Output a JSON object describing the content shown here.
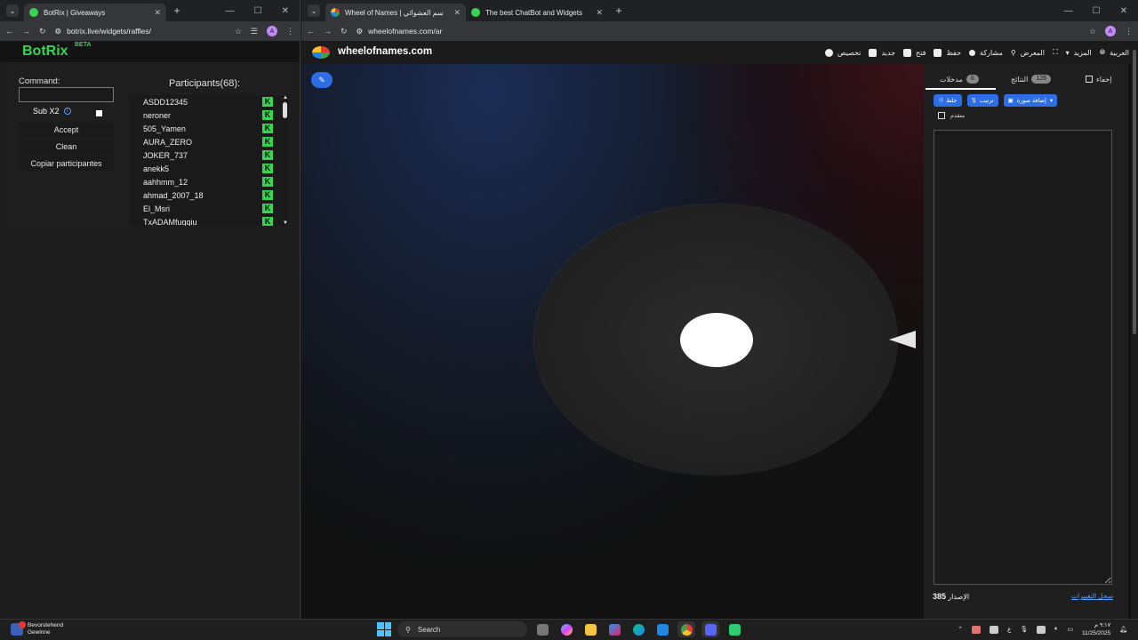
{
  "left_browser": {
    "tab_title": "BotRix | Giveaways",
    "url": "botrix.live/widgets/raffles/",
    "avatar": "A"
  },
  "botrix": {
    "logo": "BotRix",
    "beta": "BETA",
    "command_label": "Command:",
    "command_value": "",
    "sub_label": "Sub X2",
    "accept_label": "Accept",
    "clean_label": "Clean",
    "copy_label": "Copiar participantes",
    "participants_title": "Participants(68):",
    "participants": [
      "ASDD12345",
      "neroner",
      "505_Yamen",
      "AURA_ZERO",
      "JOKER_737",
      "anekk5",
      "aahhmm_12",
      "ahmad_2007_18",
      "El_Msri",
      "TxADAMfuqqiu"
    ],
    "kick_glyph": "K",
    "brand_color": "#39d353"
  },
  "right_browser": {
    "tabs": [
      "Wheel of Names | اسم العشوائي",
      "The best ChatBot and Widgets"
    ],
    "url": "wheelofnames.com/ar",
    "avatar": "A"
  },
  "wheel": {
    "site_title": "wheelofnames.com",
    "menu": {
      "customize": "تخصيص",
      "new": "جديد",
      "open": "فتح",
      "save": "حفظ",
      "share": "مشاركة",
      "gallery": "المعرض",
      "more": "المزيد",
      "language": "العربية"
    },
    "tabs": {
      "entries_label": "مدخلات",
      "entries_count": "0",
      "results_label": "النتائج",
      "results_count": "126",
      "hide_label": "إخفاء"
    },
    "buttons": {
      "shuffle": "خلط",
      "sort": "ترتيب",
      "add_image": "إضافة صورة"
    },
    "advanced_label": "متقدم",
    "version_label": "الإصدار",
    "version_number": "385",
    "changelog_label": "سجل التغييرات",
    "accent_color": "#2d6ee6"
  },
  "taskbar": {
    "notif_title": "Bevorstehend",
    "notif_sub": "Gewinne",
    "search_placeholder": "Search",
    "clock_time": "٩:١٧ م",
    "clock_date": "11/25/2025",
    "lang": "ع"
  }
}
